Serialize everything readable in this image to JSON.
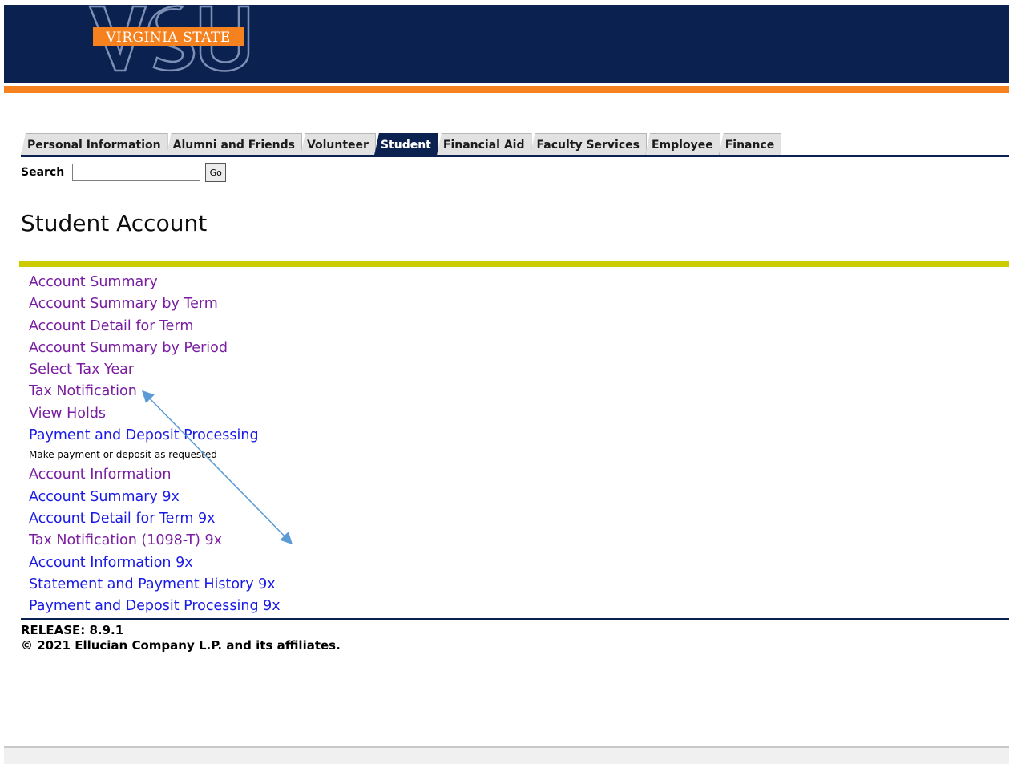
{
  "banner": {
    "logo_text": "VIRGINIA STATE",
    "logo_letters": "VSU",
    "colors": {
      "navy": "#0b2250",
      "orange": "#f5821f"
    }
  },
  "tabs": [
    {
      "label": "Personal Information",
      "active": false
    },
    {
      "label": "Alumni and Friends",
      "active": false
    },
    {
      "label": "Volunteer",
      "active": false
    },
    {
      "label": "Student",
      "active": true
    },
    {
      "label": "Financial Aid",
      "active": false
    },
    {
      "label": "Faculty Services",
      "active": false
    },
    {
      "label": "Employee",
      "active": false
    },
    {
      "label": "Finance",
      "active": false
    }
  ],
  "search": {
    "label": "Search",
    "value": "",
    "button_label": "Go"
  },
  "page": {
    "title": "Student Account"
  },
  "menu": {
    "items": [
      {
        "label": "Account Summary",
        "style": "visited"
      },
      {
        "label": "Account Summary by Term",
        "style": "visited"
      },
      {
        "label": "Account Detail for Term",
        "style": "visited"
      },
      {
        "label": "Account Summary by Period",
        "style": "visited"
      },
      {
        "label": "Select Tax Year",
        "style": "visited"
      },
      {
        "label": "Tax Notification",
        "style": "visited"
      },
      {
        "label": "View Holds",
        "style": "visited"
      },
      {
        "label": "Payment and Deposit Processing",
        "style": "link"
      },
      {
        "label": "Account Information",
        "style": "visited"
      },
      {
        "label": "Account Summary 9x",
        "style": "link"
      },
      {
        "label": "Account Detail for Term 9x",
        "style": "link"
      },
      {
        "label": "Tax Notification (1098-T) 9x",
        "style": "visited"
      },
      {
        "label": "Account Information 9x",
        "style": "link"
      },
      {
        "label": "Statement and Payment History 9x",
        "style": "link"
      },
      {
        "label": "Payment and Deposit Processing 9x",
        "style": "link"
      }
    ],
    "payment_description": "Make payment or deposit as requested"
  },
  "footer": {
    "release": "RELEASE: 8.9.1",
    "copyright": "© 2021 Ellucian Company L.P. and its affiliates."
  },
  "annotation": {
    "type": "double-headed-arrow",
    "color": "#5b9bd5"
  }
}
